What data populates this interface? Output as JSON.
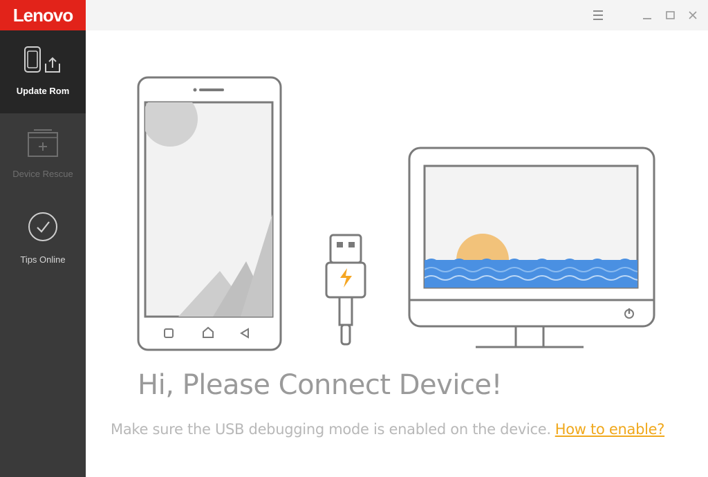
{
  "app": {
    "brand": "Lenovo",
    "brand_color": "#e2231a"
  },
  "sidebar": {
    "items": [
      {
        "label": "Update Rom",
        "icon": "phone-upload-icon",
        "state": "active"
      },
      {
        "label": "Device Rescue",
        "icon": "briefcase-rescue-icon",
        "state": "disabled"
      },
      {
        "label": "Tips Online",
        "icon": "check-circle-icon",
        "state": "normal"
      }
    ]
  },
  "titlebar": {
    "buttons": [
      "menu-icon",
      "minimize-icon",
      "maximize-icon",
      "close-icon"
    ]
  },
  "main": {
    "headline": "Hi, Please Connect Device!",
    "message": "Make sure the USB debugging mode is enabled on the device.",
    "link_text": "How to enable?",
    "link_color": "#f0a81c"
  },
  "illustration": {
    "items": [
      "phone-illustration",
      "usb-cable-illustration",
      "monitor-illustration"
    ],
    "colors": {
      "outline": "#7a7a7a",
      "sun": "#f2c27a",
      "water": "#4a90e2"
    }
  }
}
